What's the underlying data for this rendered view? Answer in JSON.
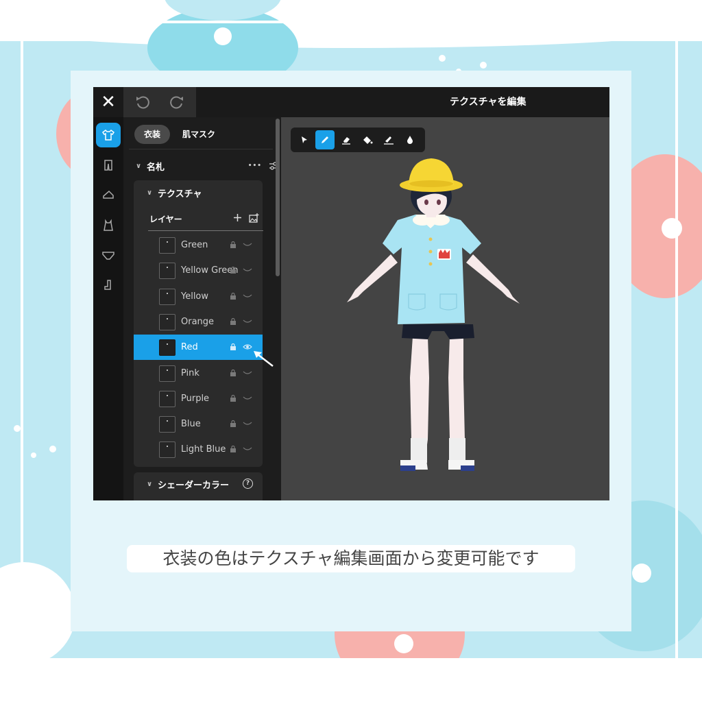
{
  "caption": "衣装の色はテクスチャ編集画面から変更可能です",
  "app": {
    "title": "テクスチャを編集",
    "close_glyph": "✕",
    "accent_color": "#1aa0e8",
    "rail_icons": [
      "shirt-icon",
      "pants-icon",
      "shoe-icon",
      "dress-icon",
      "underwear-icon",
      "sock-icon"
    ],
    "panel": {
      "tabs": [
        "衣装",
        "肌マスク"
      ],
      "active_tab": "衣装",
      "section": {
        "label": "名札",
        "more_glyph": "•••"
      },
      "texture": {
        "label": "テクスチャ",
        "layer_header": "レイヤー",
        "layers": [
          {
            "name": "Green"
          },
          {
            "name": "Yellow Green"
          },
          {
            "name": "Yellow"
          },
          {
            "name": "Orange"
          },
          {
            "name": "Red"
          },
          {
            "name": "Pink"
          },
          {
            "name": "Purple"
          },
          {
            "name": "Blue"
          },
          {
            "name": "Light Blue"
          }
        ],
        "selected_layer": "Red"
      },
      "shader": {
        "label": "シェーダーカラー",
        "help_glyph": "?"
      }
    },
    "tools": [
      "select-tool",
      "pen-tool",
      "eraser-tool",
      "fill-tool",
      "stamp-tool",
      "eyedropper-tool"
    ],
    "active_tool": "pen-tool"
  }
}
